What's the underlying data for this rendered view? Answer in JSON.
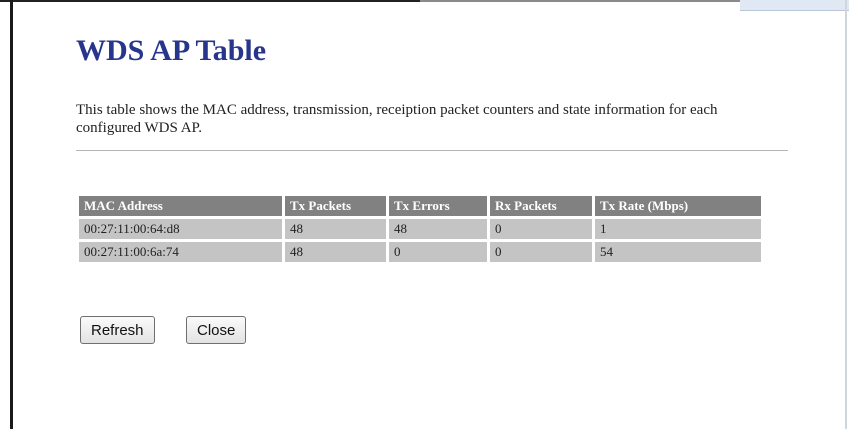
{
  "page": {
    "title": "WDS AP Table",
    "description": "This table shows the MAC address, transmission, receiption packet counters and state information for each configured WDS AP."
  },
  "table": {
    "headers": [
      "MAC Address",
      "Tx Packets",
      "Tx Errors",
      "Rx Packets",
      "Tx Rate (Mbps)"
    ],
    "rows": [
      [
        "00:27:11:00:64:d8",
        "48",
        "48",
        "0",
        "1"
      ],
      [
        "00:27:11:00:6a:74",
        "48",
        "0",
        "0",
        "54"
      ]
    ]
  },
  "buttons": {
    "refresh": "Refresh",
    "close": "Close"
  },
  "colors": {
    "title": "#27358c",
    "header_bg": "#818181",
    "cell_bg": "#c4c4c4"
  }
}
